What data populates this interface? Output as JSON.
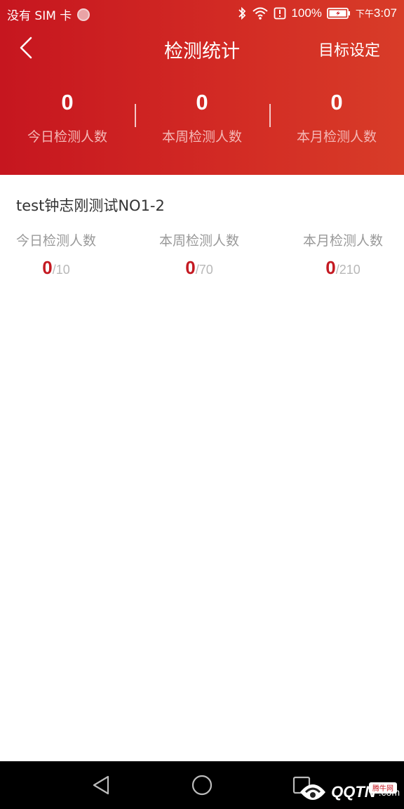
{
  "status_bar": {
    "carrier": "没有 SIM 卡",
    "battery": "100%",
    "time_prefix": "下午",
    "time": "3:07",
    "icons": [
      "bluetooth-icon",
      "wifi-icon",
      "alert-icon",
      "battery-charging-icon"
    ]
  },
  "header": {
    "title": "检测统计",
    "action": "目标设定",
    "back_icon": "chevron-left-icon",
    "colors": {
      "gradient_start": "#c6161f",
      "gradient_end": "#d83c28"
    }
  },
  "summary": [
    {
      "value": "0",
      "label": "今日检测人数"
    },
    {
      "value": "0",
      "label": "本周检测人数"
    },
    {
      "value": "0",
      "label": "本月检测人数"
    }
  ],
  "card": {
    "title": "test钟志刚测试NO1-2",
    "columns": [
      {
        "label": "今日检测人数",
        "current": "0",
        "target": "/10"
      },
      {
        "label": "本周检测人数",
        "current": "0",
        "target": "/70"
      },
      {
        "label": "本月检测人数",
        "current": "0",
        "target": "/210"
      }
    ],
    "accent": "#c41a22"
  },
  "nav": {
    "icons": [
      "back-triangle-icon",
      "home-circle-icon",
      "recents-square-icon"
    ]
  },
  "watermark": {
    "text": "QQTN",
    "suffix": ".com",
    "badge": "腾牛网"
  }
}
